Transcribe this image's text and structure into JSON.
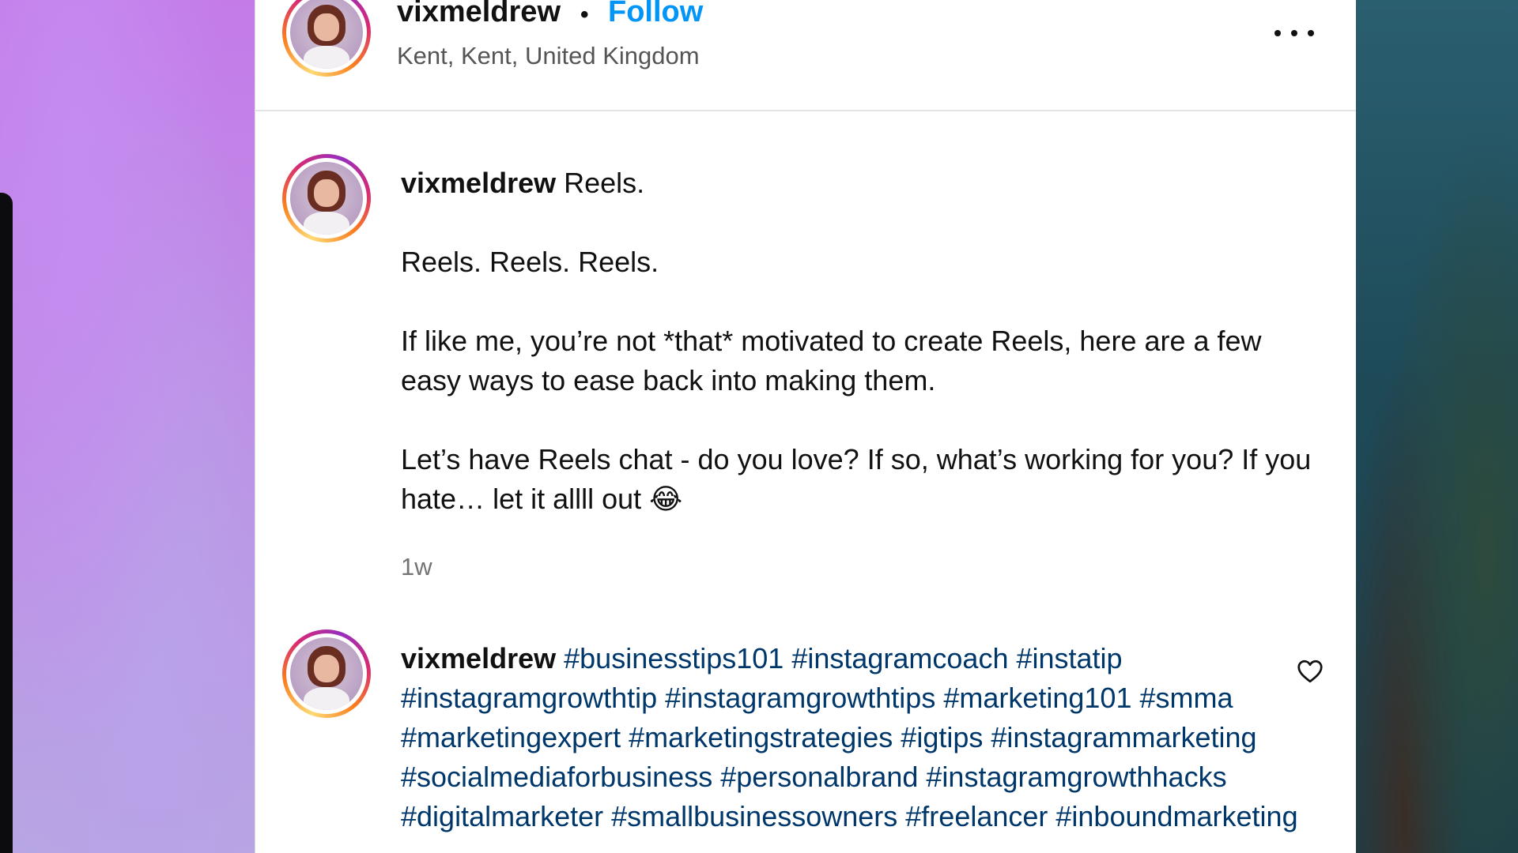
{
  "post": {
    "username": "vixmeldrew",
    "separator": "•",
    "follow_label": "Follow",
    "location": "Kent, Kent, United Kingdom",
    "more_icon": "more-horizontal-icon"
  },
  "caption": {
    "username": "vixmeldrew",
    "paragraphs": [
      "Reels.",
      "Reels. Reels. Reels.",
      "If like me, you’re not *that* motivated to create Reels, here are a few easy ways to ease back into making them.",
      "Let’s have Reels chat - do you love? If so, what’s working for you? If you hate… let it allll out"
    ],
    "emoji": "😂",
    "timestamp": "1w"
  },
  "hashtag_comment": {
    "username": "vixmeldrew",
    "text": "#businesstips101 #instagramcoach #instatip #instagramgrowthtip #instagramgrowthtips #marketing101 #smma #marketingexpert #marketingstrategies #igtips #instagrammarketing #socialmediaforbusiness #personalbrand #instagramgrowthhacks #digitalmarketer #smallbusinessowners #freelancer #inboundmarketing",
    "like_icon": "heart-outline-icon"
  }
}
